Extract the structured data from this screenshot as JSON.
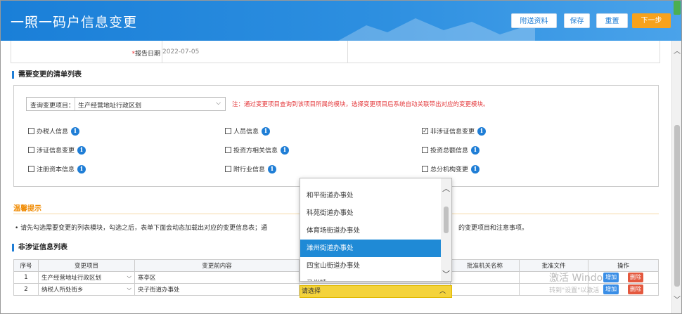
{
  "header": {
    "title": "一照一码户信息变更",
    "buttons": {
      "attach": "附送资料",
      "save": "保存",
      "reset": "重置",
      "next": "下一步"
    }
  },
  "report": {
    "label": "报告日期",
    "required": "*",
    "value": "2022-07-05"
  },
  "section_list": {
    "title": "需要变更的清单列表"
  },
  "query": {
    "label": "查询变更项目：",
    "value": "生产经营地址行政区划",
    "note": "注：通过变更项目查询到该项目所属的模块，选择变更项目后系统自动关联带出对应的变更模块。"
  },
  "checkboxes": [
    {
      "label": "办税人信息",
      "checked": false
    },
    {
      "label": "人员信息",
      "checked": false
    },
    {
      "label": "非涉证信息变更",
      "checked": true
    },
    {
      "label": "涉证信息变更",
      "checked": false
    },
    {
      "label": "投资方相关信息",
      "checked": false
    },
    {
      "label": "投资总额信息",
      "checked": false
    },
    {
      "label": "注册资本信息",
      "checked": false
    },
    {
      "label": "附行业信息",
      "checked": false
    },
    {
      "label": "总分机构变更",
      "checked": false
    }
  ],
  "tips": {
    "title": "温馨提示",
    "text": "• 请先勾选需要变更的列表模块，勾选之后，表单下面会动态加载出对应的变更信息表；通",
    "text_tail": "的变更项目和注意事项。"
  },
  "section_table": {
    "title": "非涉证信息列表"
  },
  "table": {
    "headers": [
      "序号",
      "变更项目",
      "变更前内容",
      "",
      "批准机关名称",
      "批准文件",
      "操作"
    ],
    "rows": [
      {
        "no": "1",
        "item": "生产经营地址行政区划",
        "before": "寒亭区"
      },
      {
        "no": "2",
        "item": "纳税人所处街乡",
        "before": "央子街道办事处"
      }
    ],
    "add": "增加",
    "delete": "删除"
  },
  "dropdown": {
    "options": [
      "和平街道办事处",
      "科苑街道办事处",
      "体育场街道办事处",
      "潍州街道办事处",
      "四宝山街道办事处",
      "马尚镇"
    ],
    "active_index": 3,
    "select_placeholder": "请选择"
  },
  "watermark": {
    "line1": "激活 Windo",
    "line2": "转到\"设置\"以激活"
  }
}
